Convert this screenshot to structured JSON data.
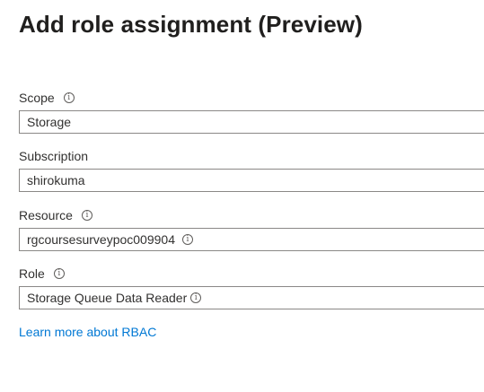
{
  "page": {
    "title": "Add role assignment (Preview)"
  },
  "form": {
    "scope": {
      "label": "Scope",
      "value": "Storage"
    },
    "subscription": {
      "label": "Subscription",
      "value": "shirokuma"
    },
    "resource": {
      "label": "Resource",
      "value": "rgcoursesurveypoc009904"
    },
    "role": {
      "label": "Role",
      "value": "Storage Queue Data Reader"
    },
    "info_glyph": "i"
  },
  "links": {
    "learn_more": "Learn more about RBAC"
  },
  "colors": {
    "link": "#0078d4",
    "border": "#8a8886",
    "text": "#323130"
  }
}
